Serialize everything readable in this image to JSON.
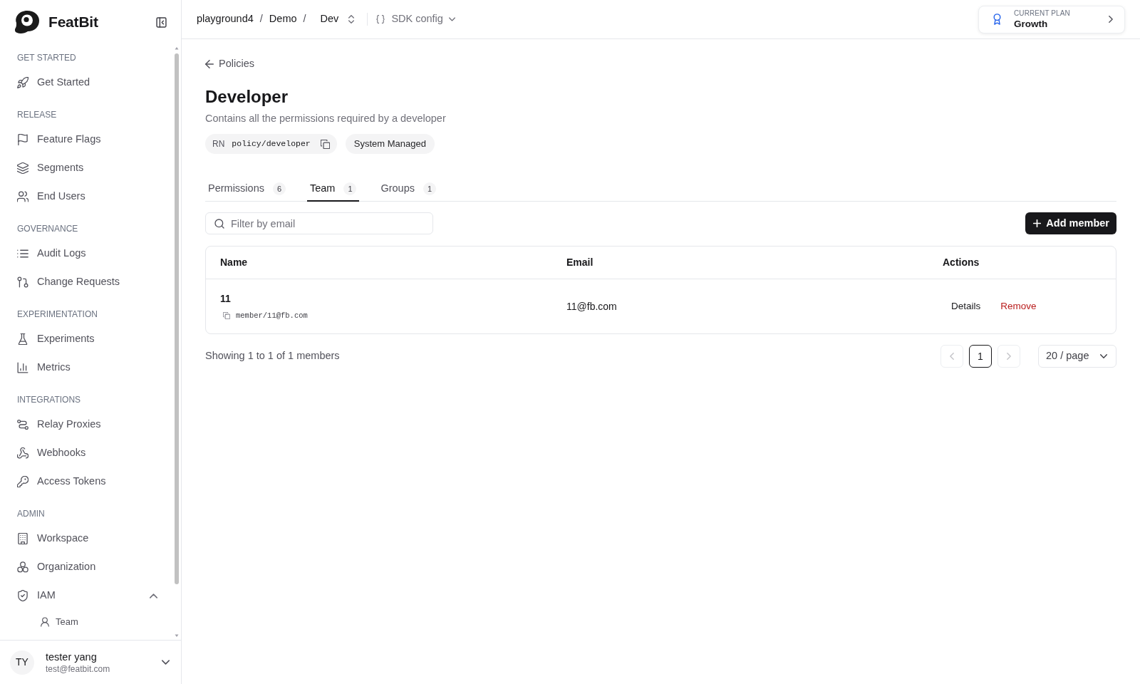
{
  "sidebar": {
    "brand": "FeatBit",
    "sections": [
      {
        "title": "GET STARTED",
        "items": [
          {
            "label": "Get Started"
          }
        ]
      },
      {
        "title": "RELEASE",
        "items": [
          {
            "label": "Feature Flags"
          },
          {
            "label": "Segments"
          },
          {
            "label": "End Users"
          }
        ]
      },
      {
        "title": "GOVERNANCE",
        "items": [
          {
            "label": "Audit Logs"
          },
          {
            "label": "Change Requests"
          }
        ]
      },
      {
        "title": "EXPERIMENTATION",
        "items": [
          {
            "label": "Experiments"
          },
          {
            "label": "Metrics"
          }
        ]
      },
      {
        "title": "INTEGRATIONS",
        "items": [
          {
            "label": "Relay Proxies"
          },
          {
            "label": "Webhooks"
          },
          {
            "label": "Access Tokens"
          }
        ]
      },
      {
        "title": "ADMIN",
        "items": [
          {
            "label": "Workspace"
          },
          {
            "label": "Organization"
          },
          {
            "label": "IAM",
            "expanded": true,
            "children": [
              {
                "label": "Team"
              }
            ]
          }
        ]
      }
    ],
    "user": {
      "initials": "TY",
      "name": "tester yang",
      "email": "test@featbit.com"
    }
  },
  "header": {
    "breadcrumb": [
      {
        "label": "playground4",
        "separator": "/"
      },
      {
        "label": "Demo",
        "separator": "/"
      },
      {
        "label": "Dev"
      }
    ],
    "sdk_config": "SDK config",
    "plan": {
      "label": "CURRENT PLAN",
      "name": "Growth"
    }
  },
  "page": {
    "back_link": "Policies",
    "title": "Developer",
    "description": "Contains all the permissions required by a developer",
    "resource_name": {
      "prefix": "RN",
      "value": "policy/developer"
    },
    "badge": "System Managed",
    "tabs": [
      {
        "label": "Permissions",
        "count": "6",
        "selected": false
      },
      {
        "label": "Team",
        "count": "1",
        "selected": true
      },
      {
        "label": "Groups",
        "count": "1",
        "selected": false
      }
    ],
    "search": {
      "placeholder": "Filter by email"
    },
    "add_button": "Add member",
    "table": {
      "columns": [
        "Name",
        "Email",
        "Actions"
      ],
      "rows": [
        {
          "name": "11",
          "resource_name": "member/11@fb.com",
          "email": "11@fb.com",
          "actions": [
            {
              "label": "Details",
              "kind": "default"
            },
            {
              "label": "Remove",
              "kind": "danger"
            }
          ]
        }
      ]
    },
    "summary": "Showing 1 to 1 of 1 members",
    "pagination": {
      "prev_disabled": true,
      "pages": [
        {
          "label": "1",
          "selected": true
        }
      ],
      "next_disabled": true,
      "page_size": "20 / page"
    }
  }
}
